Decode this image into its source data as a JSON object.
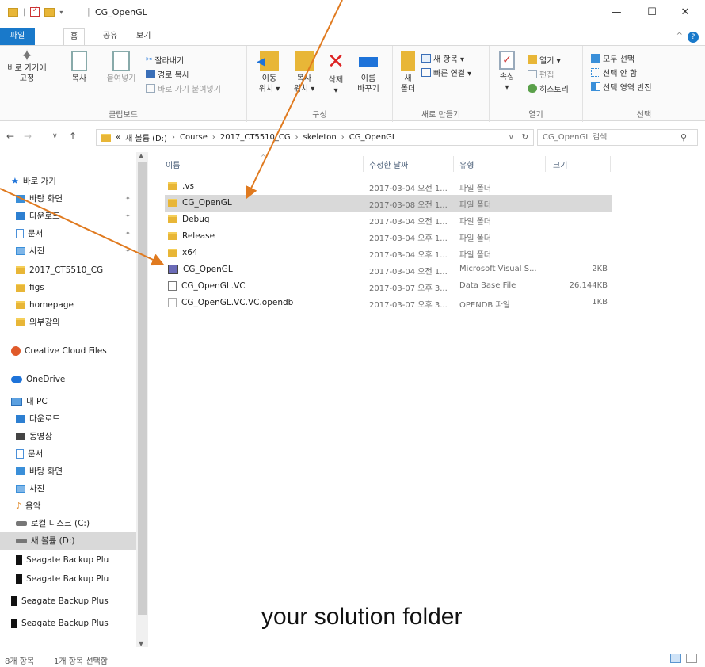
{
  "window": {
    "title": "CG_OpenGL",
    "minimize": "—",
    "maximize": "☐",
    "close": "✕",
    "help": "?"
  },
  "ribbon_tabs": [
    "파일",
    "홈",
    "공유",
    "보기"
  ],
  "ribbon": {
    "clipboard": {
      "label": "클립보드",
      "pin": "바로 가기에\n고정",
      "copy": "복사",
      "paste": "붙여넣기",
      "cut": "잘라내기",
      "copy_path": "경로 복사",
      "paste_shortcut": "바로 가기 붙여넣기"
    },
    "organize": {
      "label": "구성",
      "move": "이동\n위치 ▾",
      "copyto": "복사\n위치 ▾",
      "delete": "삭제\n▾",
      "rename": "이름\n바꾸기"
    },
    "new": {
      "label": "새로 만들기",
      "new_folder": "새\n폴더",
      "new_item": "새 항목 ▾",
      "easy_access": "빠른 연결 ▾"
    },
    "open": {
      "label": "열기",
      "properties": "속성\n▾",
      "open": "열기 ▾",
      "edit": "편집",
      "history": "히스토리"
    },
    "select": {
      "label": "선택",
      "select_all": "모두 선택",
      "select_none": "선택 안 함",
      "invert": "선택 영역 반전"
    }
  },
  "address": {
    "path": [
      "«",
      "새 볼륨 (D:)",
      "Course",
      "2017_CT5510_CG",
      "skeleton",
      "CG_OpenGL"
    ],
    "search_placeholder": "CG_OpenGL 검색"
  },
  "sidebar": {
    "items": [
      {
        "label": "바로 가기",
        "icon": "star-icon",
        "pinned": false
      },
      {
        "label": "바탕 화면",
        "icon": "desktop-icon",
        "pinned": true
      },
      {
        "label": "다운로드",
        "icon": "download-icon",
        "pinned": true
      },
      {
        "label": "문서",
        "icon": "document-icon",
        "pinned": true
      },
      {
        "label": "사진",
        "icon": "pictures-icon",
        "pinned": true
      },
      {
        "label": "2017_CT5510_CG",
        "icon": "folder-icon",
        "pinned": false
      },
      {
        "label": "figs",
        "icon": "folder-icon",
        "pinned": false
      },
      {
        "label": "homepage",
        "icon": "folder-icon",
        "pinned": false
      },
      {
        "label": "외부강의",
        "icon": "folder-icon",
        "pinned": false
      },
      {
        "label": "Creative Cloud Files",
        "icon": "creative-cloud-icon",
        "pinned": false
      },
      {
        "label": "OneDrive",
        "icon": "onedrive-icon",
        "pinned": false
      },
      {
        "label": "내 PC",
        "icon": "pc-icon",
        "pinned": false
      },
      {
        "label": "다운로드",
        "icon": "download-icon",
        "pinned": false
      },
      {
        "label": "동영상",
        "icon": "video-icon",
        "pinned": false
      },
      {
        "label": "문서",
        "icon": "document-icon",
        "pinned": false
      },
      {
        "label": "바탕 화면",
        "icon": "desktop-icon",
        "pinned": false
      },
      {
        "label": "사진",
        "icon": "pictures-icon",
        "pinned": false
      },
      {
        "label": "음악",
        "icon": "music-icon",
        "pinned": false
      },
      {
        "label": "로컬 디스크 (C:)",
        "icon": "disk-icon",
        "pinned": false
      },
      {
        "label": "새 볼륨 (D:)",
        "icon": "disk-icon",
        "pinned": false,
        "selected": true
      },
      {
        "label": "Seagate Backup Plu",
        "icon": "drive-icon",
        "pinned": false
      },
      {
        "label": "Seagate Backup Plu",
        "icon": "drive-icon",
        "pinned": false
      },
      {
        "label": "Seagate Backup Plus",
        "icon": "drive-icon",
        "pinned": false
      },
      {
        "label": "Seagate Backup Plus",
        "icon": "drive-icon",
        "pinned": false
      }
    ]
  },
  "columns": [
    "이름",
    "수정한 날짜",
    "유형",
    "크기"
  ],
  "files": [
    {
      "name": ".vs",
      "date": "2017-03-04 오전 1...",
      "type": "파일 폴더",
      "size": "",
      "icon": "folder-icon"
    },
    {
      "name": "CG_OpenGL",
      "date": "2017-03-08 오전 1...",
      "type": "파일 폴더",
      "size": "",
      "icon": "folder-icon",
      "selected": true
    },
    {
      "name": "Debug",
      "date": "2017-03-04 오전 1...",
      "type": "파일 폴더",
      "size": "",
      "icon": "folder-icon"
    },
    {
      "name": "Release",
      "date": "2017-03-04 오후 1...",
      "type": "파일 폴더",
      "size": "",
      "icon": "folder-icon"
    },
    {
      "name": "x64",
      "date": "2017-03-04 오후 1...",
      "type": "파일 폴더",
      "size": "",
      "icon": "folder-icon"
    },
    {
      "name": "CG_OpenGL",
      "date": "2017-03-04 오전 1...",
      "type": "Microsoft Visual S...",
      "size": "2KB",
      "icon": "solution-icon"
    },
    {
      "name": "CG_OpenGL.VC",
      "date": "2017-03-07 오후 3...",
      "type": "Data Base File",
      "size": "26,144KB",
      "icon": "database-file-icon"
    },
    {
      "name": "CG_OpenGL.VC.VC.opendb",
      "date": "2017-03-07 오후 3...",
      "type": "OPENDB 파일",
      "size": "1KB",
      "icon": "file-icon"
    }
  ],
  "status": {
    "count": "8개 항목",
    "selected": "1개 항목 선택함"
  },
  "annotation": {
    "caption": "your solution folder",
    "arrow_color": "#e07a1f"
  }
}
